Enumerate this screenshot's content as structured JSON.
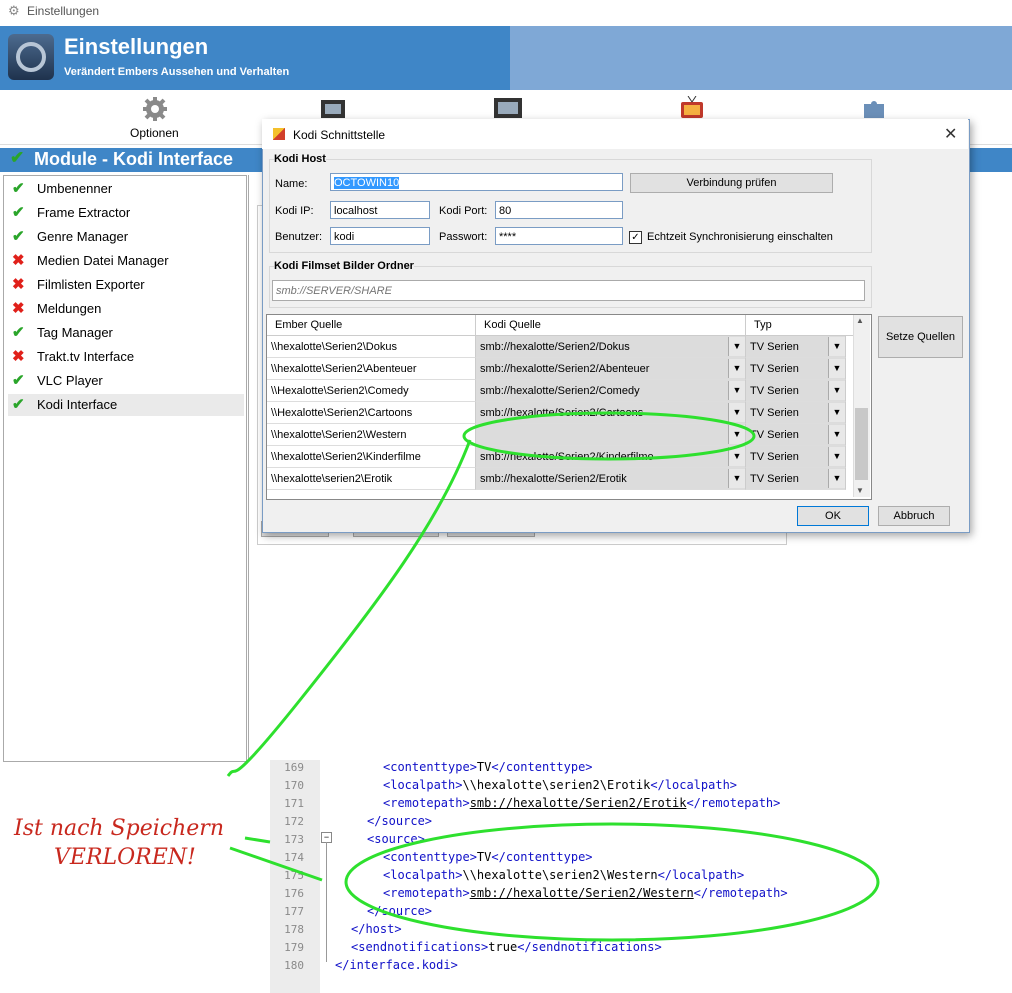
{
  "window": {
    "title": "Einstellungen"
  },
  "banner": {
    "title": "Einstellungen",
    "subtitle": "Verändert Embers Aussehen und Verhalten"
  },
  "toolbar": {
    "optionen_label": "Optionen"
  },
  "module": {
    "title": "Module - Kodi Interface"
  },
  "sidebar": {
    "items": [
      {
        "label": "Umbenenner",
        "status": "ok"
      },
      {
        "label": "Frame Extractor",
        "status": "ok"
      },
      {
        "label": "Genre Manager",
        "status": "ok"
      },
      {
        "label": "Medien Datei Manager",
        "status": "disabled"
      },
      {
        "label": "Filmlisten Exporter",
        "status": "disabled"
      },
      {
        "label": "Meldungen",
        "status": "disabled"
      },
      {
        "label": "Tag Manager",
        "status": "ok"
      },
      {
        "label": "Trakt.tv Interface",
        "status": "disabled"
      },
      {
        "label": "VLC Player",
        "status": "ok"
      },
      {
        "label": "Kodi Interface",
        "status": "ok"
      }
    ],
    "check_glyph": "✔",
    "cross_glyph": "✖"
  },
  "dialog": {
    "title": "Kodi Schnittstelle",
    "close_glyph": "✕",
    "host_group": "Kodi Host",
    "name_label": "Name:",
    "name_value": "OCTOWIN10",
    "test_button": "Verbindung prüfen",
    "ip_label": "Kodi IP:",
    "ip_value": "localhost",
    "port_label": "Kodi Port:",
    "port_value": "80",
    "user_label": "Benutzer:",
    "user_value": "kodi",
    "password_label": "Passwort:",
    "password_value": "****",
    "realtime_sync_label": "Echtzeit Synchronisierung einschalten",
    "realtime_sync_checked": true,
    "filmset_group": "Kodi Filmset Bilder Ordner",
    "filmset_placeholder": "smb://SERVER/SHARE",
    "grid_headers": [
      "Ember Quelle",
      "Kodi Quelle",
      "Typ"
    ],
    "grid_rows": [
      {
        "ember": "\\\\hexalotte\\Serien2\\Dokus",
        "kodi": "smb://hexalotte/Serien2/Dokus",
        "typ": "TV Serien"
      },
      {
        "ember": "\\\\hexalotte\\Serien2\\Abenteuer",
        "kodi": "smb://hexalotte/Serien2/Abenteuer",
        "typ": "TV Serien"
      },
      {
        "ember": "\\\\Hexalotte\\Serien2\\Comedy",
        "kodi": "smb://hexalotte/Serien2/Comedy",
        "typ": "TV Serien"
      },
      {
        "ember": "\\\\Hexalotte\\Serien2\\Cartoons",
        "kodi": "smb://hexalotte/Serien2/Cartoons",
        "typ": "TV Serien"
      },
      {
        "ember": "\\\\hexalotte\\Serien2\\Western",
        "kodi": "",
        "typ": "TV Serien"
      },
      {
        "ember": "\\\\hexalotte\\Serien2\\Kinderfilme",
        "kodi": "smb://hexalotte/Serien2/Kinderfilme",
        "typ": "TV Serien"
      },
      {
        "ember": "\\\\hexalotte\\serien2\\Erotik",
        "kodi": "smb://hexalotte/Serien2/Erotik",
        "typ": "TV Serien"
      }
    ],
    "set_sources_button": "Setze Quellen",
    "ok_button": "OK",
    "cancel_button": "Abbruch"
  },
  "code": {
    "lines": [
      {
        "n": "169",
        "indent": 3,
        "html": "<span class='tag'>&lt;contenttype&gt;</span>TV<span class='tag'>&lt;/contenttype&gt;</span>"
      },
      {
        "n": "170",
        "indent": 3,
        "html": "<span class='tag'>&lt;localpath&gt;</span>\\\\hexalotte\\serien2\\Erotik<span class='tag'>&lt;/localpath&gt;</span>"
      },
      {
        "n": "171",
        "indent": 3,
        "html": "<span class='tag'>&lt;remotepath&gt;</span><span class='u'>smb://hexalotte/Serien2/Erotik</span><span class='tag'>&lt;/remotepath&gt;</span>"
      },
      {
        "n": "172",
        "indent": 2,
        "html": "<span class='tag'>&lt;/source&gt;</span>"
      },
      {
        "n": "173",
        "indent": 2,
        "html": "<span class='tag'>&lt;source&gt;</span>"
      },
      {
        "n": "174",
        "indent": 3,
        "html": "<span class='tag'>&lt;contenttype&gt;</span>TV<span class='tag'>&lt;/contenttype&gt;</span>"
      },
      {
        "n": "175",
        "indent": 3,
        "html": "<span class='tag'>&lt;localpath&gt;</span>\\\\hexalotte\\serien2\\Western<span class='tag'>&lt;/localpath&gt;</span>"
      },
      {
        "n": "176",
        "indent": 3,
        "html": "<span class='tag'>&lt;remotepath&gt;</span><span class='u'>smb://hexalotte/Serien2/Western</span><span class='tag'>&lt;/remotepath&gt;</span>"
      },
      {
        "n": "177",
        "indent": 2,
        "html": "<span class='tag'>&lt;/source&gt;</span>"
      },
      {
        "n": "178",
        "indent": 1,
        "html": "<span class='tag'>&lt;/host&gt;</span>"
      },
      {
        "n": "179",
        "indent": 1,
        "html": "<span class='tag'>&lt;sendnotifications&gt;</span>true<span class='tag'>&lt;/sendnotifications&gt;</span>"
      },
      {
        "n": "180",
        "indent": 0,
        "html": "<span class='tag'>&lt;/interface.kodi&gt;</span>"
      }
    ]
  },
  "annotation": {
    "line1": "Ist nach Speichern",
    "line2": "VERLOREN!",
    "color": "#c8281e",
    "highlight_color": "#2ee02e"
  }
}
